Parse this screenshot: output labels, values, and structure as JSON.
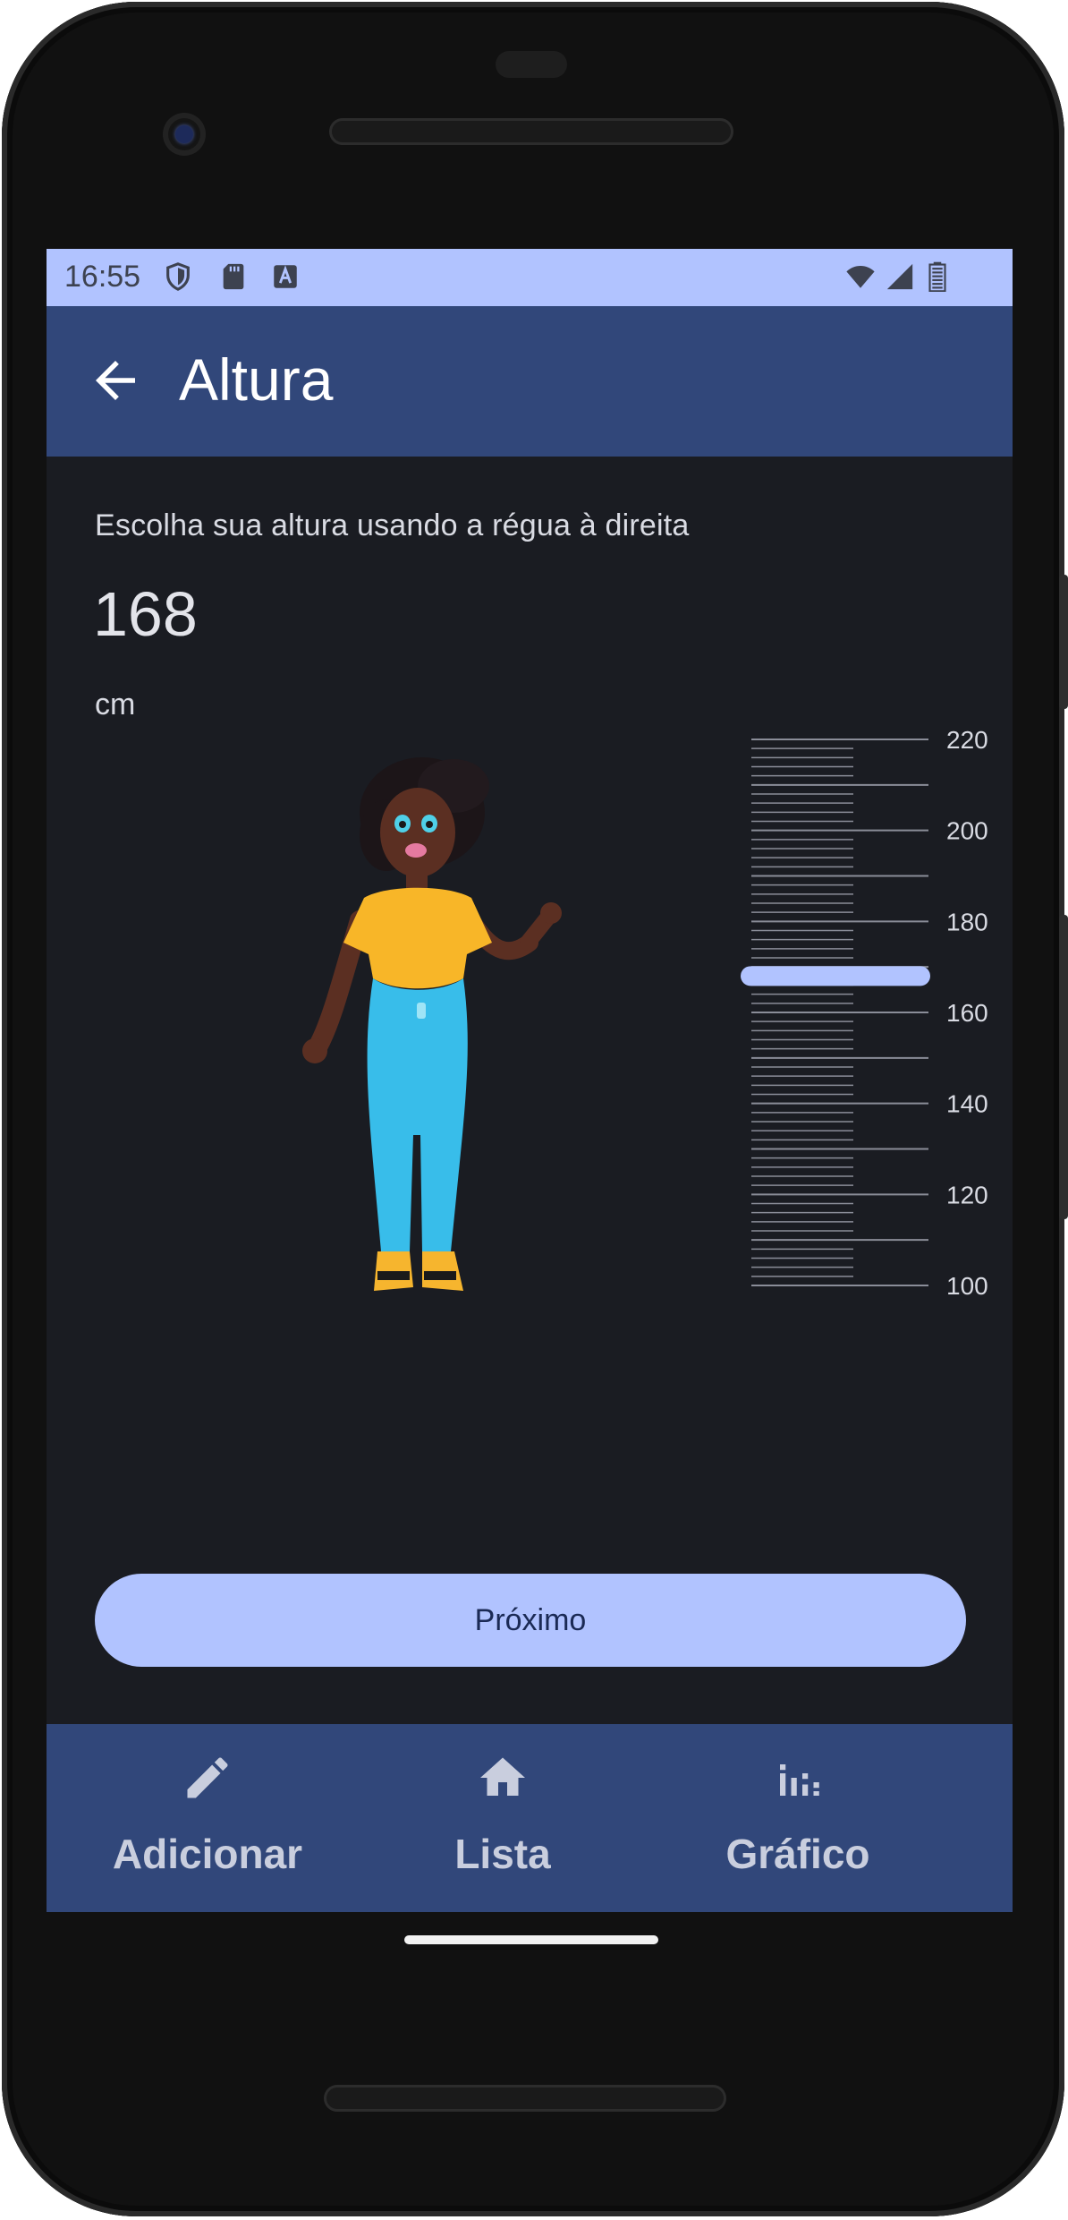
{
  "status_bar": {
    "time": "16:55",
    "left_icons": [
      "shield-icon",
      "sd-card-icon",
      "keyboard-a-icon"
    ],
    "right_icons": [
      "wifi-icon",
      "cell-signal-icon",
      "battery-icon"
    ]
  },
  "app_bar": {
    "back_icon": "arrow-back-icon",
    "title": "Altura"
  },
  "content": {
    "instruction": "Escolha sua altura usando a régua à direita",
    "height_value": "168",
    "height_unit": "cm"
  },
  "ruler": {
    "labels": [
      "220",
      "200",
      "180",
      "160",
      "140",
      "120",
      "100"
    ],
    "min": 100,
    "max": 220,
    "selected": 168,
    "colors": {
      "tick": "#8a8d98",
      "label": "#d9dbe3",
      "handle": "#b1c3ff"
    }
  },
  "next_button": {
    "label": "Próximo"
  },
  "bottom_nav": {
    "items": [
      {
        "icon": "pencil-icon",
        "label": "Adicionar"
      },
      {
        "icon": "home-icon",
        "label": "Lista"
      },
      {
        "icon": "bar-chart-icon",
        "label": "Gráfico"
      }
    ]
  },
  "colors": {
    "primary_container": "#b1c3ff",
    "app_bar": "#31477a",
    "background": "#1a1c22"
  }
}
